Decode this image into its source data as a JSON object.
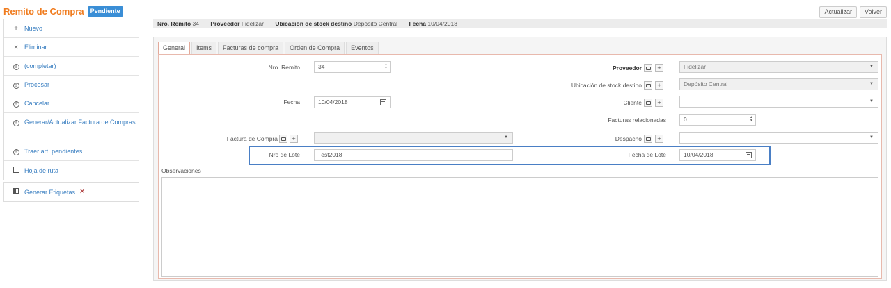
{
  "header": {
    "title": "Remito de Compra",
    "status": "Pendiente",
    "update_btn": "Actualizar",
    "back_btn": "Volver"
  },
  "sidebar": {
    "groups": [
      [
        {
          "label": "Nuevo",
          "icon": "plus-icon"
        },
        {
          "label": "Eliminar",
          "icon": "close-icon"
        },
        {
          "label": "(completar)",
          "icon": "info-icon"
        },
        {
          "label": "Procesar",
          "icon": "info-icon"
        },
        {
          "label": "Cancelar",
          "icon": "info-icon"
        },
        {
          "label": "Generar/Actualizar Factura de Compras",
          "icon": "info-icon"
        },
        {
          "label": "Traer art. pendientes",
          "icon": "info-icon"
        },
        {
          "label": "Hoja de ruta",
          "icon": "calendar-icon"
        }
      ],
      [
        {
          "label": "Generar Etiquetas",
          "icon": "barcode-icon"
        }
      ]
    ]
  },
  "info": {
    "nro_label": "Nro. Remito",
    "nro_value": "34",
    "prov_label": "Proveedor",
    "prov_value": "Fidelizar",
    "ubic_label": "Ubicación de stock destino",
    "ubic_value": "Depósito Central",
    "fecha_label": "Fecha",
    "fecha_value": "10/04/2018"
  },
  "tabs": [
    "General",
    "Items",
    "Facturas de compra",
    "Orden de Compra",
    "Eventos"
  ],
  "form": {
    "nro_remito": {
      "label": "Nro. Remito",
      "value": "34"
    },
    "fecha": {
      "label": "Fecha",
      "value": "10/04/2018"
    },
    "factura": {
      "label": "Factura de Compra",
      "value": ""
    },
    "nro_lote": {
      "label": "Nro de Lote",
      "value": "Test2018"
    },
    "observaciones": {
      "label": "Observaciones"
    },
    "proveedor": {
      "label": "Proveedor",
      "value": "Fidelizar"
    },
    "ubicacion": {
      "label": "Ubicación de stock destino",
      "value": "Depósito Central"
    },
    "cliente": {
      "label": "Cliente",
      "value": "..."
    },
    "facturas_rel": {
      "label": "Facturas relacionadas",
      "value": "0"
    },
    "despacho": {
      "label": "Despacho",
      "value": "..."
    },
    "fecha_lote": {
      "label": "Fecha de Lote",
      "value": "10/04/2018"
    }
  }
}
